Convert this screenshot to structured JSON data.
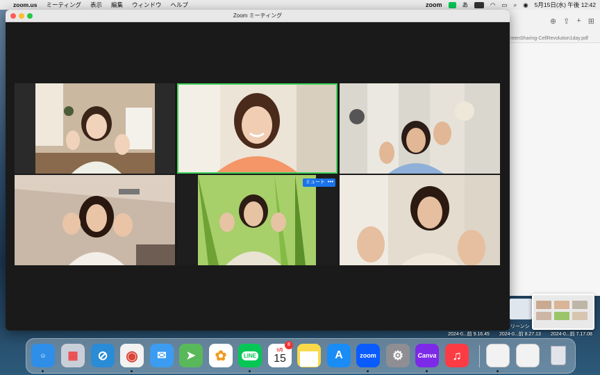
{
  "menubar": {
    "app_name": "zoom.us",
    "menus": [
      "ミーティング",
      "表示",
      "編集",
      "ウィンドウ",
      "ヘルプ"
    ],
    "status_zoom": "zoom",
    "status_line": "LINE",
    "input_method": "あ",
    "datetime": "5月15日(水) 午後 12:42"
  },
  "background_window": {
    "filename": "reenSharing-CellRevolution1day.pdf"
  },
  "zoom_window": {
    "title": "Zoom ミーティング",
    "tile_overlay": {
      "mute_label": "ミュート",
      "more_label": "•••"
    },
    "active_speaker_color": "#3fd35a"
  },
  "desktop": {
    "labels": [
      "2024-0...前 9.16.45",
      "2024-0...前 8.27.13",
      "2024-0...前 7.17.08"
    ],
    "partial_label": "リーンシ"
  },
  "dock": {
    "apps": [
      {
        "name": "Finder",
        "color": "#2f8ee8"
      },
      {
        "name": "Launchpad",
        "color": "#c9cfd9"
      },
      {
        "name": "Safari",
        "color": "#2a8bd6"
      },
      {
        "name": "Chrome",
        "color": "#f2f2f2"
      },
      {
        "name": "Mail",
        "color": "#3b9cf2"
      },
      {
        "name": "Maps",
        "color": "#58b85a"
      },
      {
        "name": "Photos",
        "color": "#ffffff"
      },
      {
        "name": "LINE",
        "color": "#06c755",
        "label": "LINE"
      },
      {
        "name": "Calendar",
        "color": "#ffffff",
        "month": "5月",
        "day": "15",
        "badge": "8"
      },
      {
        "name": "Notes",
        "color": "#f9d94a"
      },
      {
        "name": "App Store",
        "color": "#1a8cf5"
      },
      {
        "name": "Zoom",
        "color": "#0b5cff",
        "label": "zoom"
      },
      {
        "name": "System Settings",
        "color": "#8e8e93"
      },
      {
        "name": "Canva",
        "color": "#7d2ae8",
        "label": "Canva"
      },
      {
        "name": "Music",
        "color": "#fc3c44"
      }
    ]
  }
}
